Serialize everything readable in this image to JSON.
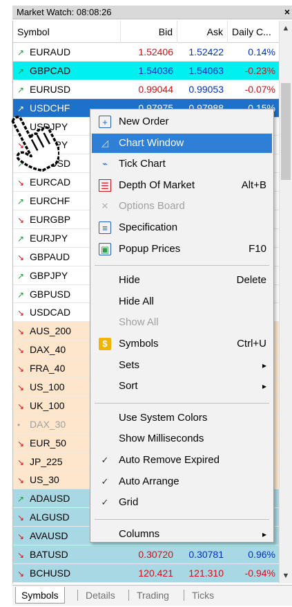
{
  "window": {
    "title": "Market Watch: 08:08:26",
    "close_label": "×"
  },
  "columns": {
    "symbol": "Symbol",
    "bid": "Bid",
    "ask": "Ask",
    "daily": "Daily C..."
  },
  "rows": [
    {
      "arrow": "↗",
      "symbol": "EURAUD",
      "bid": "1.52406",
      "ask": "1.52422",
      "daily": "0.14%",
      "bg": "#ffffff",
      "arrow_color": "#1a9a3a",
      "bid_color": "#d0101a",
      "ask_color": "#0030c0",
      "daily_color": "#0030c0"
    },
    {
      "arrow": "↗",
      "symbol": "GBPCAD",
      "bid": "1.54036",
      "ask": "1.54063",
      "daily": "-0.23%",
      "bg": "#00f0f0",
      "arrow_color": "#1a9a3a",
      "bid_color": "#0030c0",
      "ask_color": "#0030c0",
      "daily_color": "#d0101a"
    },
    {
      "arrow": "↗",
      "symbol": "EURUSD",
      "bid": "0.99044",
      "ask": "0.99053",
      "daily": "-0.07%",
      "bg": "#ffffff",
      "arrow_color": "#1a9a3a",
      "bid_color": "#d0101a",
      "ask_color": "#0030c0",
      "daily_color": "#d0101a"
    },
    {
      "arrow": "↗",
      "symbol": "USDCHF",
      "bid": "0.97975",
      "ask": "0.97988",
      "daily": "0.15%",
      "bg": "#1f70c8",
      "arrow_color": "#ffffff",
      "bid_color": "#ffffff",
      "ask_color": "#ffffff",
      "daily_color": "#ffffff",
      "text_color": "#ffffff"
    },
    {
      "arrow": "↘",
      "symbol": "USDJPY",
      "bid": "",
      "ask": "",
      "daily": "",
      "bg": "#ffffff",
      "arrow_color": "#d0101a"
    },
    {
      "arrow": "↘",
      "symbol": "AUDJPY",
      "bid": "",
      "ask": "",
      "daily": "",
      "bg": "#ffffff",
      "arrow_color": "#d0101a"
    },
    {
      "arrow": "↗",
      "symbol": "AUDUSD",
      "bid": "",
      "ask": "",
      "daily": "",
      "bg": "#ffffff",
      "arrow_color": "#1a9a3a"
    },
    {
      "arrow": "↘",
      "symbol": "EURCAD",
      "bid": "",
      "ask": "",
      "daily": "",
      "bg": "#ffffff",
      "arrow_color": "#d0101a"
    },
    {
      "arrow": "↗",
      "symbol": "EURCHF",
      "bid": "",
      "ask": "",
      "daily": "",
      "bg": "#ffffff",
      "arrow_color": "#1a9a3a"
    },
    {
      "arrow": "↘",
      "symbol": "EURGBP",
      "bid": "",
      "ask": "",
      "daily": "",
      "bg": "#ffffff",
      "arrow_color": "#d0101a"
    },
    {
      "arrow": "↗",
      "symbol": "EURJPY",
      "bid": "",
      "ask": "",
      "daily": "",
      "bg": "#ffffff",
      "arrow_color": "#1a9a3a"
    },
    {
      "arrow": "↘",
      "symbol": "GBPAUD",
      "bid": "",
      "ask": "",
      "daily": "",
      "bg": "#ffffff",
      "arrow_color": "#d0101a"
    },
    {
      "arrow": "↗",
      "symbol": "GBPJPY",
      "bid": "",
      "ask": "",
      "daily": "",
      "bg": "#ffffff",
      "arrow_color": "#1a9a3a"
    },
    {
      "arrow": "↗",
      "symbol": "GBPUSD",
      "bid": "",
      "ask": "",
      "daily": "",
      "bg": "#ffffff",
      "arrow_color": "#1a9a3a"
    },
    {
      "arrow": "↘",
      "symbol": "USDCAD",
      "bid": "",
      "ask": "",
      "daily": "",
      "bg": "#ffffff",
      "arrow_color": "#d0101a"
    },
    {
      "arrow": "↘",
      "symbol": "AUS_200",
      "bid": "",
      "ask": "",
      "daily": "",
      "bg": "#fde6cc",
      "arrow_color": "#d0101a"
    },
    {
      "arrow": "↘",
      "symbol": "DAX_40",
      "bid": "",
      "ask": "",
      "daily": "",
      "bg": "#fde6cc",
      "arrow_color": "#d0101a"
    },
    {
      "arrow": "↘",
      "symbol": "FRA_40",
      "bid": "",
      "ask": "",
      "daily": "",
      "bg": "#fde6cc",
      "arrow_color": "#d0101a"
    },
    {
      "arrow": "↘",
      "symbol": "US_100",
      "bid": "",
      "ask": "",
      "daily": "",
      "bg": "#fde6cc",
      "arrow_color": "#d0101a"
    },
    {
      "arrow": "↘",
      "symbol": "UK_100",
      "bid": "",
      "ask": "",
      "daily": "",
      "bg": "#fde6cc",
      "arrow_color": "#d0101a"
    },
    {
      "arrow": "•",
      "symbol": "DAX_30",
      "bid": "",
      "ask": "",
      "daily": "",
      "bg": "#fde6cc",
      "arrow_color": "#a0a0a0",
      "text_color": "#a0a0a0"
    },
    {
      "arrow": "↘",
      "symbol": "EUR_50",
      "bid": "",
      "ask": "",
      "daily": "",
      "bg": "#fde6cc",
      "arrow_color": "#d0101a"
    },
    {
      "arrow": "↘",
      "symbol": "JP_225",
      "bid": "",
      "ask": "",
      "daily": "",
      "bg": "#fde6cc",
      "arrow_color": "#d0101a"
    },
    {
      "arrow": "↘",
      "symbol": "US_30",
      "bid": "",
      "ask": "",
      "daily": "",
      "bg": "#fde6cc",
      "arrow_color": "#d0101a"
    },
    {
      "arrow": "↗",
      "symbol": "ADAUSD",
      "bid": "",
      "ask": "",
      "daily": "",
      "bg": "#a8d8e4",
      "arrow_color": "#1a9a3a"
    },
    {
      "arrow": "↘",
      "symbol": "ALGUSD",
      "bid": "",
      "ask": "",
      "daily": "",
      "bg": "#a8d8e4",
      "arrow_color": "#d0101a"
    },
    {
      "arrow": "↘",
      "symbol": "AVAUSD",
      "bid": "",
      "ask": "",
      "daily": "",
      "bg": "#a8d8e4",
      "arrow_color": "#d0101a"
    },
    {
      "arrow": "↘",
      "symbol": "BATUSD",
      "bid": "0.30720",
      "ask": "0.30781",
      "daily": "0.96%",
      "bg": "#a8d8e4",
      "arrow_color": "#d0101a",
      "bid_color": "#d0101a",
      "ask_color": "#0030c0",
      "daily_color": "#0030c0"
    },
    {
      "arrow": "↘",
      "symbol": "BCHUSD",
      "bid": "120.421",
      "ask": "121.310",
      "daily": "-0.94%",
      "bg": "#a8d8e4",
      "arrow_color": "#d0101a",
      "bid_color": "#d0101a",
      "ask_color": "#d0101a",
      "daily_color": "#d0101a"
    }
  ],
  "menu": [
    {
      "type": "item",
      "icon": "plus-box-icon",
      "glyph": "+",
      "label": "New Order",
      "shortcut": ""
    },
    {
      "type": "item",
      "icon": "chart-window-icon",
      "glyph": "◿",
      "label": "Chart Window",
      "shortcut": "",
      "highlight": true
    },
    {
      "type": "item",
      "icon": "tick-chart-icon",
      "glyph": "⌁",
      "label": "Tick Chart",
      "shortcut": ""
    },
    {
      "type": "item",
      "icon": "depth-of-market-icon",
      "glyph": "☰",
      "label": "Depth Of Market",
      "shortcut": "Alt+B"
    },
    {
      "type": "item",
      "icon": "options-board-icon",
      "glyph": "✕",
      "label": "Options Board",
      "shortcut": "",
      "disabled": true
    },
    {
      "type": "item",
      "icon": "specification-icon",
      "glyph": "≡",
      "label": "Specification",
      "shortcut": ""
    },
    {
      "type": "item",
      "icon": "popup-prices-icon",
      "glyph": "▣",
      "label": "Popup Prices",
      "shortcut": "F10"
    },
    {
      "type": "sep"
    },
    {
      "type": "item",
      "icon": "",
      "glyph": "",
      "label": "Hide",
      "shortcut": "Delete"
    },
    {
      "type": "item",
      "icon": "",
      "glyph": "",
      "label": "Hide All",
      "shortcut": ""
    },
    {
      "type": "item",
      "icon": "",
      "glyph": "",
      "label": "Show All",
      "shortcut": "",
      "disabled": true
    },
    {
      "type": "item",
      "icon": "dollar-icon",
      "glyph": "$",
      "label": "Symbols",
      "shortcut": "Ctrl+U"
    },
    {
      "type": "item",
      "icon": "",
      "glyph": "",
      "label": "Sets",
      "shortcut": "▸"
    },
    {
      "type": "item",
      "icon": "",
      "glyph": "",
      "label": "Sort",
      "shortcut": "▸"
    },
    {
      "type": "sep"
    },
    {
      "type": "item",
      "icon": "",
      "glyph": "",
      "label": "Use System Colors",
      "shortcut": ""
    },
    {
      "type": "item",
      "icon": "",
      "glyph": "",
      "label": "Show Milliseconds",
      "shortcut": ""
    },
    {
      "type": "item",
      "icon": "checkmark-icon",
      "glyph": "✓",
      "label": "Auto Remove Expired",
      "shortcut": ""
    },
    {
      "type": "item",
      "icon": "checkmark-icon",
      "glyph": "✓",
      "label": "Auto Arrange",
      "shortcut": ""
    },
    {
      "type": "item",
      "icon": "checkmark-icon",
      "glyph": "✓",
      "label": "Grid",
      "shortcut": ""
    },
    {
      "type": "sep"
    },
    {
      "type": "item",
      "icon": "",
      "glyph": "",
      "label": "Columns",
      "shortcut": "▸"
    }
  ],
  "tabs": [
    {
      "label": "Symbols",
      "active": true
    },
    {
      "label": "Details",
      "active": false
    },
    {
      "label": "Trading",
      "active": false
    },
    {
      "label": "Ticks",
      "active": false
    }
  ],
  "scroll": {
    "up": "▲",
    "down": "▼"
  }
}
